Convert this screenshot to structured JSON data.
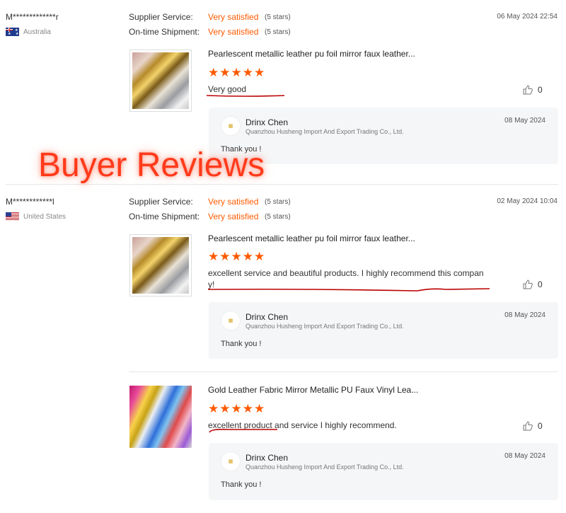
{
  "overlay_title": "Buyer Reviews",
  "reviews": [
    {
      "user": "M*************r",
      "country": "Australia",
      "supplier_label": "Supplier Service:",
      "supplier_value": "Very satisfied",
      "supplier_stars": "(5 stars)",
      "shipment_label": "On-time Shipment:",
      "shipment_value": "Very satisfied",
      "shipment_stars": "(5 stars)",
      "date": "06 May 2024 22:54",
      "items": [
        {
          "product": "Pearlescent metallic leather pu foil mirror faux leather...",
          "rating": "★★★★★",
          "comment": "Very good",
          "likes": "0",
          "reply": {
            "name": "Drinx Chen",
            "company": "Quanzhou Husheng Import And Export Trading Co., Ltd.",
            "date": "08 May 2024",
            "text": "Thank you !"
          }
        }
      ]
    },
    {
      "user": "M************l",
      "country": "United States",
      "supplier_label": "Supplier Service:",
      "supplier_value": "Very satisfied",
      "supplier_stars": "(5 stars)",
      "shipment_label": "On-time Shipment:",
      "shipment_value": "Very satisfied",
      "shipment_stars": "(5 stars)",
      "date": "02 May 2024 10:04",
      "items": [
        {
          "product": "Pearlescent metallic leather pu foil mirror faux leather...",
          "rating": "★★★★★",
          "comment_line1": "excellent service and beautiful products. I highly recommend this compan",
          "comment_line2": "y!",
          "likes": "0",
          "reply": {
            "name": "Drinx Chen",
            "company": "Quanzhou Husheng Import And Export Trading Co., Ltd.",
            "date": "08 May 2024",
            "text": "Thank you !"
          }
        },
        {
          "product": "Gold Leather Fabric Mirror Metallic PU Faux Vinyl Lea...",
          "rating": "★★★★★",
          "comment": "excellent product and service I highly recommend.",
          "likes": "0",
          "reply": {
            "name": "Drinx Chen",
            "company": "Quanzhou Husheng Import And Export Trading Co., Ltd.",
            "date": "08 May 2024",
            "text": "Thank you !"
          }
        }
      ]
    }
  ],
  "colors": {
    "accent": "#ff5a00",
    "underline": "#b00000",
    "reply_bg": "#f5f6f8"
  },
  "icons": {
    "like": "thumbs-up-icon",
    "avatar": "supplier-logo"
  }
}
